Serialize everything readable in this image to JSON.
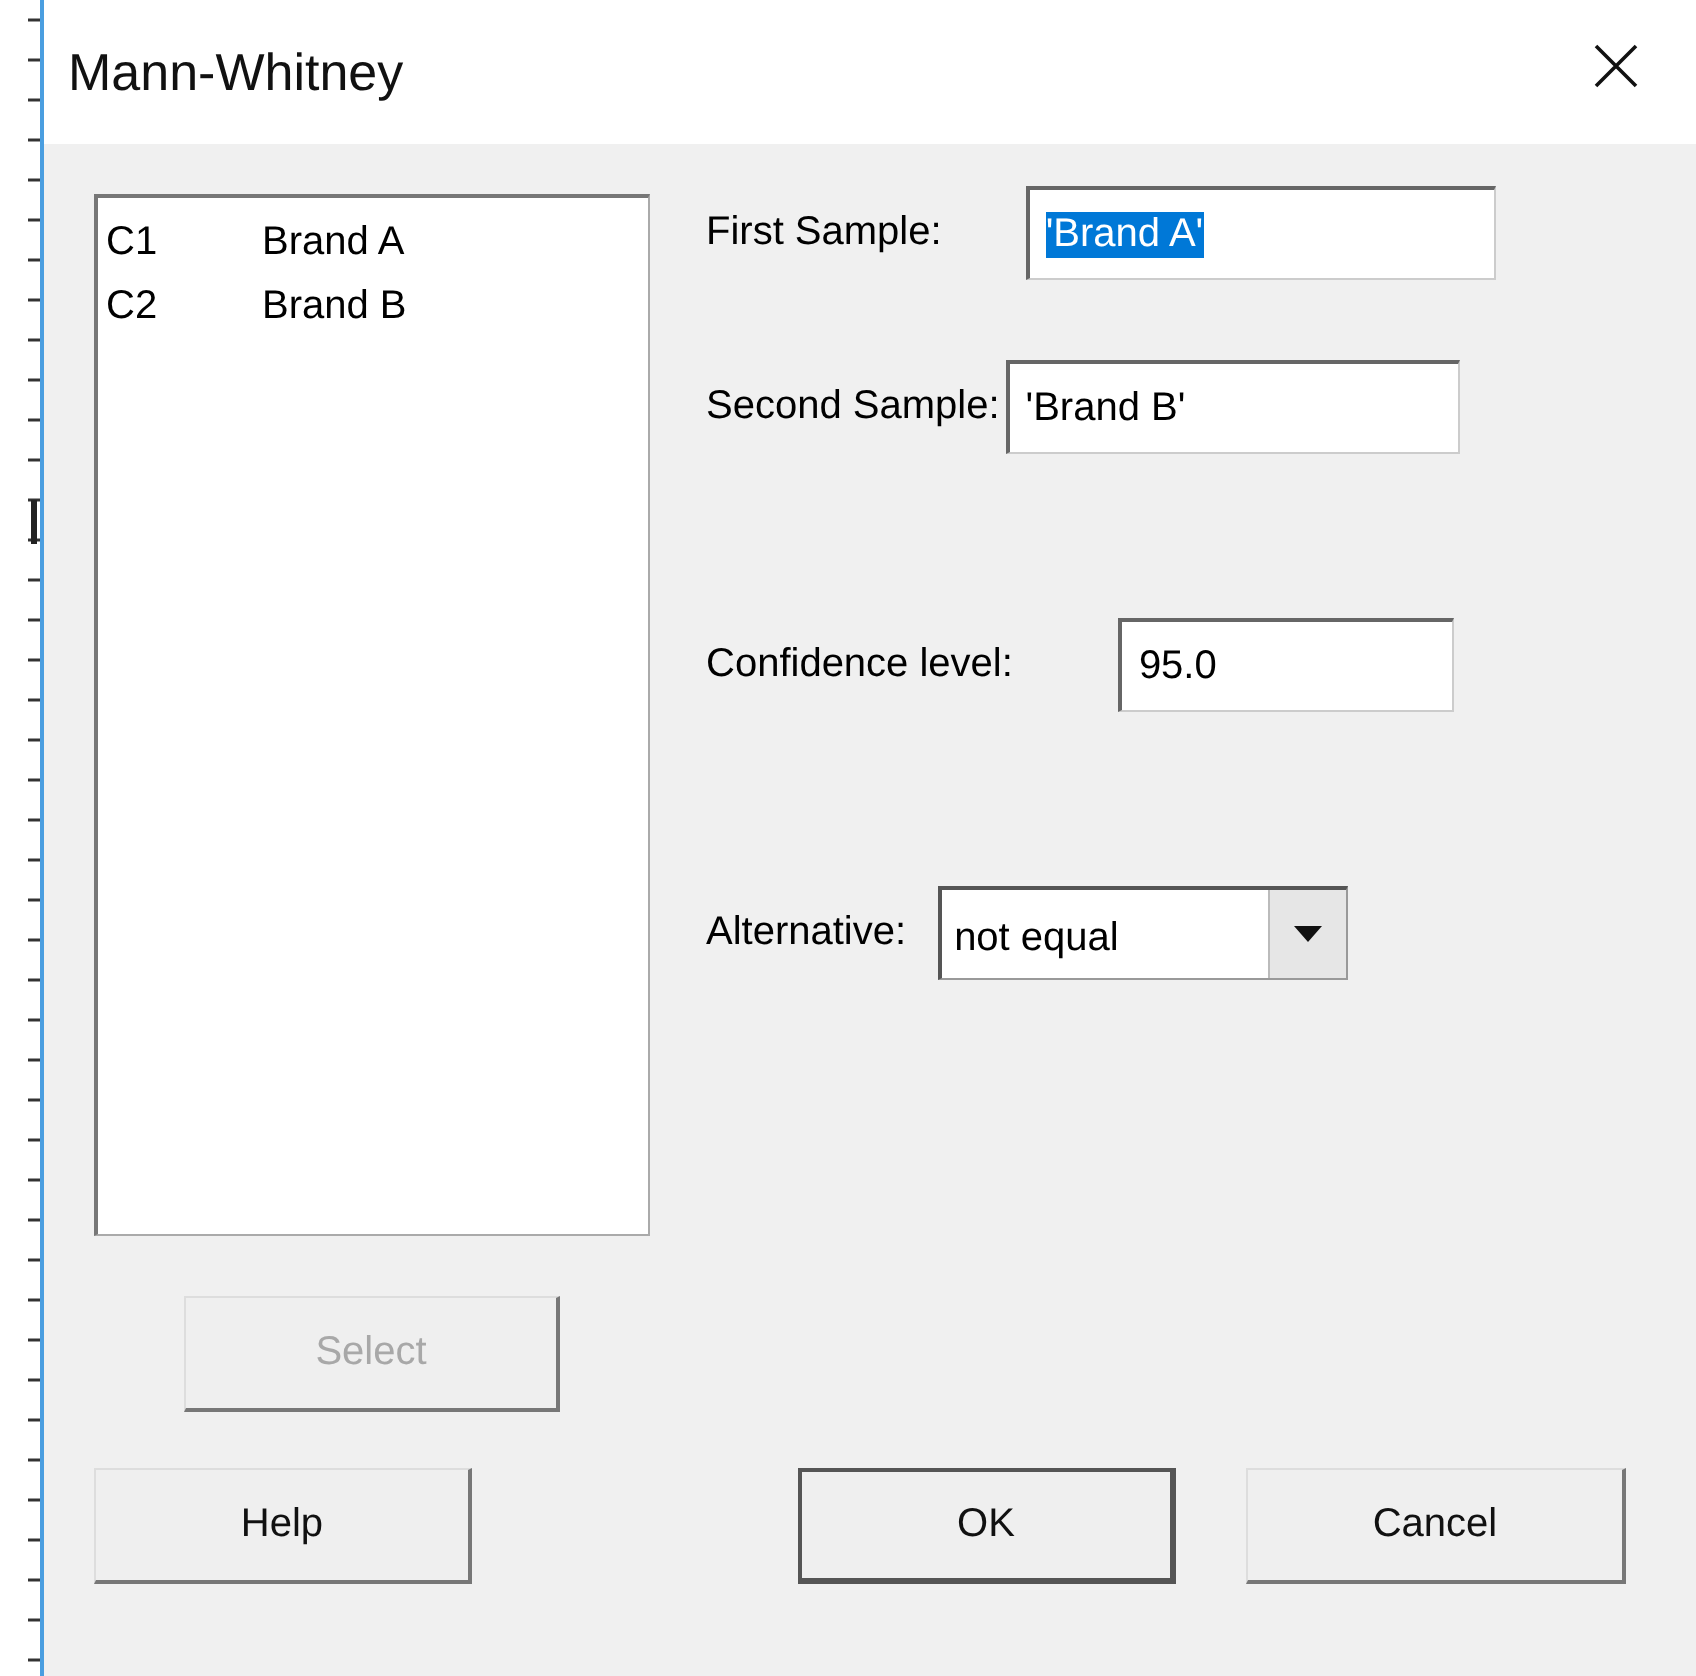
{
  "window": {
    "title": "Mann-Whitney"
  },
  "columns": [
    {
      "id": "C1",
      "name": "Brand A"
    },
    {
      "id": "C2",
      "name": "Brand B"
    }
  ],
  "fields": [
    {
      "kind": "text",
      "label": "First Sample:",
      "value": "'Brand A'",
      "highlighted": true
    },
    {
      "kind": "text",
      "label": "Second Sample:",
      "value": "'Brand B'",
      "highlighted": false
    },
    {
      "kind": "text",
      "label": "Confidence level:",
      "value": "95.0",
      "highlighted": false
    },
    {
      "kind": "dropdown",
      "label": "Alternative:",
      "value": "not equal"
    }
  ],
  "select_button": {
    "label": "Select",
    "disabled": true
  },
  "buttons": [
    {
      "label": "Help",
      "default": false
    },
    {
      "label": "OK",
      "default": true
    },
    {
      "label": "Cancel",
      "default": false
    }
  ]
}
